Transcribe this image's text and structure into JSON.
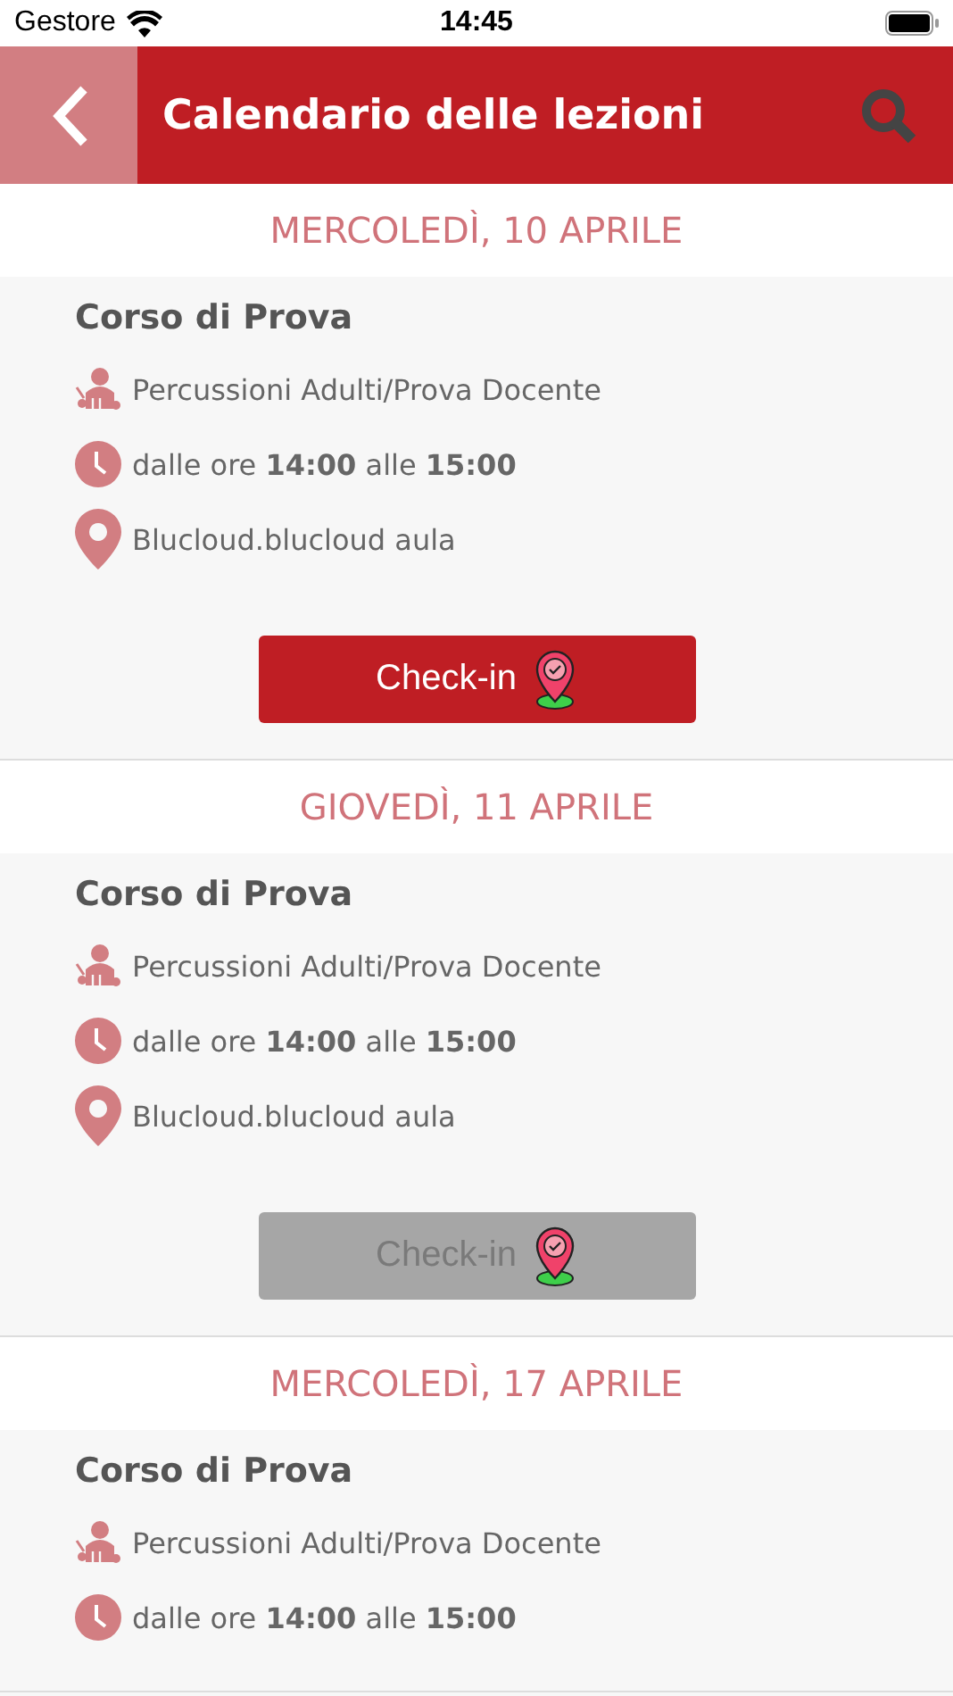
{
  "status_bar": {
    "carrier": "Gestore",
    "time": "14:45"
  },
  "header": {
    "title": "Calendario delle lezioni"
  },
  "lessons": [
    {
      "date": "MERCOLEDÌ, 10 APRILE",
      "title": "Corso di Prova",
      "teacher": "Percussioni Adulti/Prova Docente",
      "time": "dalle ore **14:00** alle **15:00**",
      "location": "Blucloud.blucloud aula",
      "checkin": {
        "label": "Check-in",
        "disabled": false
      }
    },
    {
      "date": "GIOVEDÌ, 11 APRILE",
      "title": "Corso di Prova",
      "teacher": "Percussioni Adulti/Prova Docente",
      "time": "dalle ore **14:00** alle **15:00**",
      "location": "Blucloud.blucloud aula",
      "checkin": {
        "label": "Check-in",
        "disabled": true
      }
    },
    {
      "date": "MERCOLEDÌ, 17 APRILE",
      "title": "Corso di Prova",
      "teacher": "Percussioni Adulti/Prova Docente",
      "time": "dalle ore **14:00** alle **15:00**"
    }
  ]
}
